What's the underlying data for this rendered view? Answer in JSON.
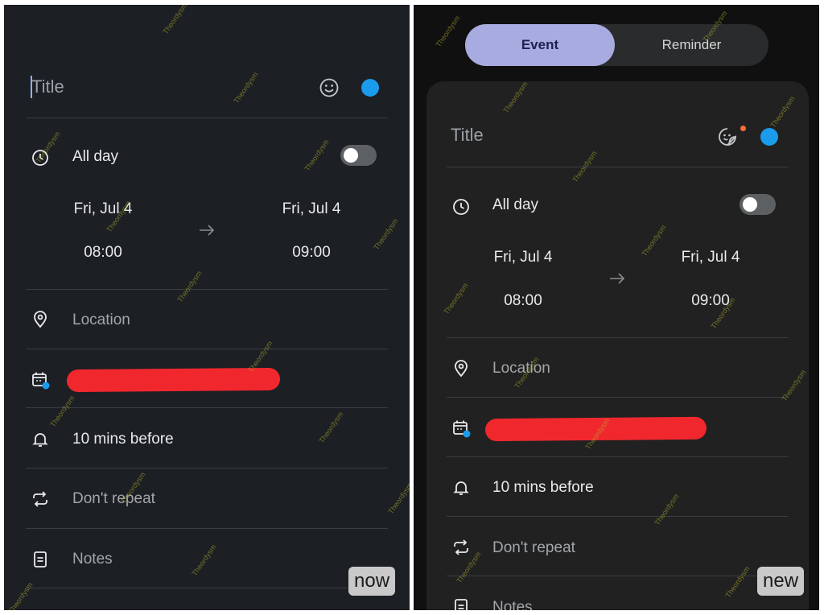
{
  "left": {
    "title_placeholder": "Title",
    "all_day_label": "All day",
    "start_date": "Fri, Jul 4",
    "start_time": "08:00",
    "end_date": "Fri, Jul 4",
    "end_time": "09:00",
    "location_placeholder": "Location",
    "reminder_label": "10 mins before",
    "repeat_label": "Don't repeat",
    "notes_placeholder": "Notes",
    "corner_tag": "now",
    "all_day_on": false
  },
  "right": {
    "segment": {
      "event_label": "Event",
      "reminder_label": "Reminder",
      "selected": "Event"
    },
    "title_placeholder": "Title",
    "all_day_label": "All day",
    "start_date": "Fri, Jul 4",
    "start_time": "08:00",
    "end_date": "Fri, Jul 4",
    "end_time": "09:00",
    "location_placeholder": "Location",
    "reminder_label": "10 mins before",
    "repeat_label": "Don't repeat",
    "notes_placeholder": "Notes",
    "corner_tag": "new",
    "all_day_on": false
  },
  "watermark": "Theordysm",
  "colors": {
    "left_background": "#1c1f23",
    "right_background": "#101010",
    "sheet": "#212121",
    "accent_blue": "#1a9bec",
    "segment_selected": "#a8abdf",
    "redaction": "#f0282e",
    "notification_dot": "#ff6d3a"
  },
  "icons": [
    "smiley-icon",
    "sticker-icon",
    "clock-icon",
    "arrow-right-icon",
    "location-pin-icon",
    "calendar-icon",
    "bell-icon",
    "repeat-icon",
    "notes-icon"
  ]
}
